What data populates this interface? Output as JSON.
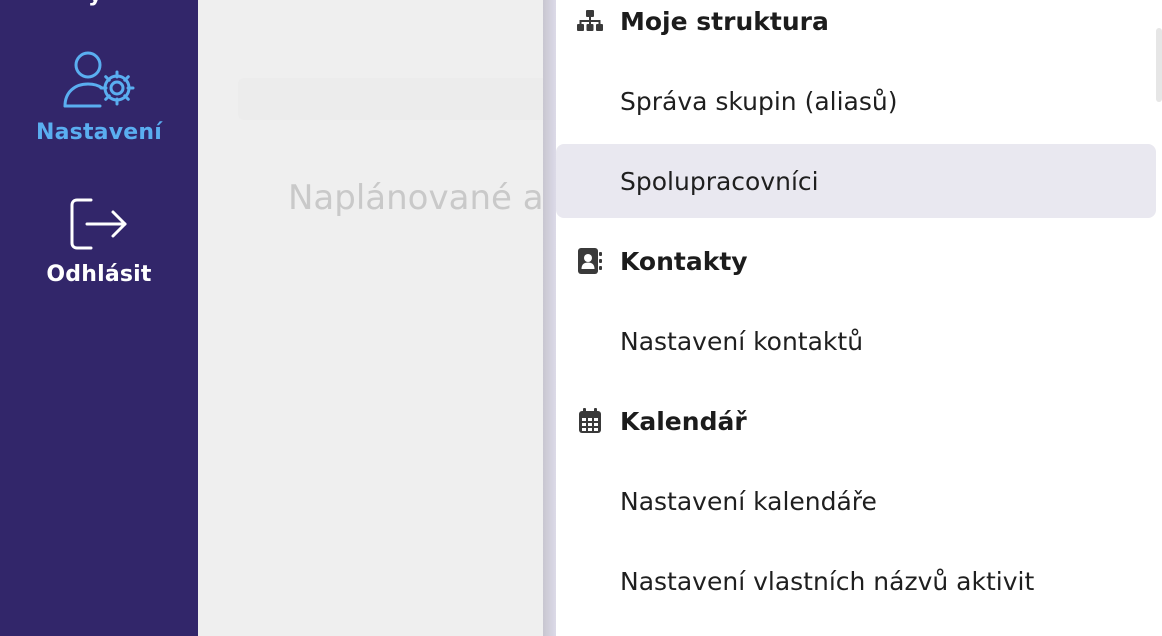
{
  "sidebar": {
    "partial_label": "y",
    "settings": {
      "label": "Nastavení",
      "icon": "user-gear-icon",
      "color": "#5aaef0"
    },
    "logout": {
      "label": "Odhlásit",
      "icon": "logout-icon"
    },
    "background": "#32266a"
  },
  "main": {
    "title": "Naplánované a"
  },
  "menu": {
    "sections": [
      {
        "title": "Moje struktura",
        "icon": "hierarchy-icon",
        "items": [
          "Správa skupin (aliasů)",
          "Spolupracovníci"
        ]
      },
      {
        "title": "Kontakty",
        "icon": "address-book-icon",
        "items": [
          "Nastavení kontaktů"
        ]
      },
      {
        "title": "Kalendář",
        "icon": "calendar-icon",
        "items": [
          "Nastavení kalendáře",
          "Nastavení vlastních názvů aktivit"
        ]
      }
    ],
    "selected_item": "Spolupracovníci",
    "selected_background": "#e9e8f0"
  }
}
